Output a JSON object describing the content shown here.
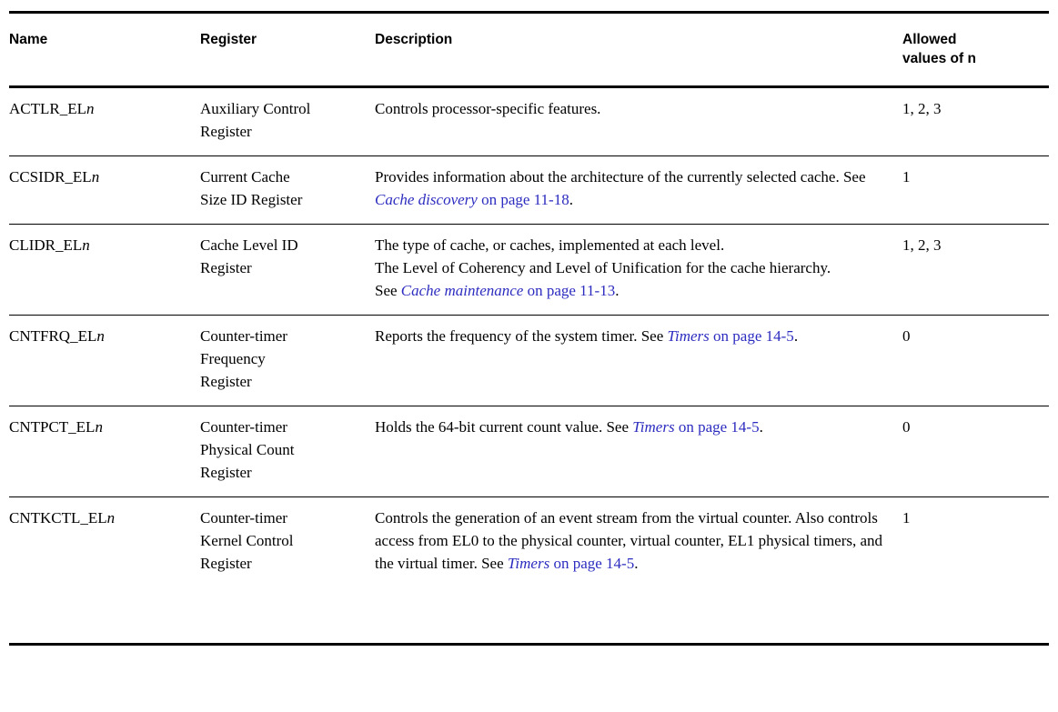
{
  "table": {
    "columns": [
      {
        "key": "name",
        "label": "Name"
      },
      {
        "key": "register",
        "label": "Register"
      },
      {
        "key": "description",
        "label": "Description"
      },
      {
        "key": "allowed",
        "label": "Allowed values of n",
        "label_line1": "Allowed",
        "label_line2": "values of n"
      }
    ],
    "link_color": "#2c2cc0",
    "rows": [
      {
        "name_base": "ACTLR_EL",
        "name_suffix": "n",
        "register": "Auxiliary Control Register",
        "register_line1": "Auxiliary Control",
        "register_line2": "Register",
        "description_paragraphs": [
          {
            "text": "Controls processor-specific features.",
            "link_title": "",
            "link_tail": "",
            "trailing": ""
          }
        ],
        "allowed": "1, 2, 3"
      },
      {
        "name_base": "CCSIDR_EL",
        "name_suffix": "n",
        "register": "Current Cache Size ID Register",
        "register_line1": "Current Cache",
        "register_line2": "Size ID Register",
        "description_paragraphs": [
          {
            "text": "Provides information about the architecture of the currently selected cache. See ",
            "link_title": "Cache discovery",
            "link_tail": " on page 11-18",
            "trailing": "."
          }
        ],
        "allowed": "1"
      },
      {
        "name_base": "CLIDR_EL",
        "name_suffix": "n",
        "register": "Cache Level ID Register",
        "register_line1": "Cache Level ID",
        "register_line2": "Register",
        "description_paragraphs": [
          {
            "text": "The type of cache, or caches, implemented at each level.",
            "link_title": "",
            "link_tail": "",
            "trailing": ""
          },
          {
            "text": "The Level of Coherency and Level of Unification for the cache hierarchy.",
            "link_title": "",
            "link_tail": "",
            "trailing": ""
          },
          {
            "text": "See ",
            "link_title": "Cache maintenance",
            "link_tail": " on page 11-13",
            "trailing": "."
          }
        ],
        "allowed": "1, 2, 3"
      },
      {
        "name_base": "CNTFRQ_EL",
        "name_suffix": "n",
        "register": "Counter-timer Frequency Register",
        "register_line1": "Counter-timer",
        "register_line2": "Frequency",
        "register_line3": "Register",
        "description_paragraphs": [
          {
            "text": "Reports the frequency of the system timer. See ",
            "link_title": "Timers",
            "link_tail": " on page 14-5",
            "trailing": "."
          }
        ],
        "allowed": "0"
      },
      {
        "name_base": "CNTPCT_EL",
        "name_suffix": "n",
        "register": "Counter-timer Physical Count Register",
        "register_line1": "Counter-timer",
        "register_line2": "Physical Count",
        "register_line3": "Register",
        "description_paragraphs": [
          {
            "text": "Holds the 64-bit current count value. See ",
            "link_title": "Timers",
            "link_tail": " on page 14-5",
            "trailing": "."
          }
        ],
        "allowed": "0"
      },
      {
        "name_base": "CNTKCTL_EL",
        "name_suffix": "n",
        "register": "Counter-timer Kernel Control Register",
        "register_line1": "Counter-timer",
        "register_line2": "Kernel Control",
        "register_line3": "Register",
        "description_paragraphs": [
          {
            "text": "Controls the generation of an event stream from the virtual counter. Also controls access from EL0 to the physical counter, virtual counter, EL1 physical timers, and the virtual timer. See ",
            "link_title": "Timers",
            "link_tail": " on page 14-5",
            "trailing": "."
          }
        ],
        "allowed": "1"
      }
    ]
  }
}
